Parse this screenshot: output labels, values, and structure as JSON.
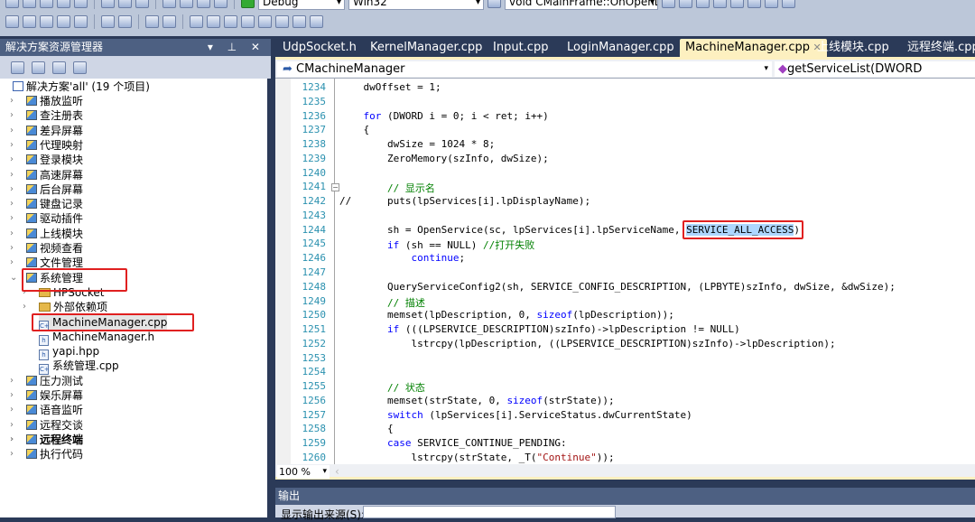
{
  "toolbar": {
    "config": "Debug",
    "platform": "Win32",
    "function_combo": "void CMainFrame::OnOpenDe"
  },
  "solution_explorer": {
    "title": "解决方案资源管理器",
    "buttons": "▾ ⊥ ✕",
    "root": "解决方案'all' (19 个项目)",
    "items": [
      {
        "label": "播放监听",
        "type": "project"
      },
      {
        "label": "查注册表",
        "type": "project"
      },
      {
        "label": "差异屏幕",
        "type": "project"
      },
      {
        "label": "代理映射",
        "type": "project"
      },
      {
        "label": "登录模块",
        "type": "project"
      },
      {
        "label": "高速屏幕",
        "type": "project"
      },
      {
        "label": "后台屏幕",
        "type": "project"
      },
      {
        "label": "键盘记录",
        "type": "project"
      },
      {
        "label": "驱动插件",
        "type": "project"
      },
      {
        "label": "上线模块",
        "type": "project"
      },
      {
        "label": "视频查看",
        "type": "project"
      },
      {
        "label": "文件管理",
        "type": "project"
      },
      {
        "label": "系统管理",
        "type": "project",
        "expanded": true,
        "highlighted": true
      },
      {
        "label": "HPSocket",
        "type": "folder",
        "child": true
      },
      {
        "label": "外部依赖项",
        "type": "folder",
        "child": true
      },
      {
        "label": "MachineManager.cpp",
        "type": "cpp",
        "child": true,
        "selected": true,
        "highlighted": true
      },
      {
        "label": "MachineManager.h",
        "type": "h",
        "child": true
      },
      {
        "label": "yapi.hpp",
        "type": "h",
        "child": true
      },
      {
        "label": "系统管理.cpp",
        "type": "cpp",
        "child": true
      },
      {
        "label": "压力测试",
        "type": "project"
      },
      {
        "label": "娱乐屏幕",
        "type": "project"
      },
      {
        "label": "语音监听",
        "type": "project"
      },
      {
        "label": "远程交谈",
        "type": "project"
      },
      {
        "label": "远程终端",
        "type": "project",
        "bold": true
      },
      {
        "label": "执行代码",
        "type": "project"
      }
    ]
  },
  "tabs": [
    {
      "label": "UdpSocket.h"
    },
    {
      "label": "KernelManager.cpp"
    },
    {
      "label": "Input.cpp"
    },
    {
      "label": "LoginManager.cpp"
    },
    {
      "label": "MachineManager.cpp",
      "active": true,
      "close": "✕"
    },
    {
      "label": "上线模块.cpp"
    },
    {
      "label": "远程终端.cpp"
    }
  ],
  "nav": {
    "class": "CMachineManager",
    "member": "getServiceList(DWORD dwScType)"
  },
  "code": {
    "lines": [
      {
        "n": "1234",
        "seg": [
          [
            "    dwOffset = 1;",
            ""
          ]
        ]
      },
      {
        "n": "1235",
        "seg": []
      },
      {
        "n": "1236",
        "seg": [
          [
            "    ",
            ""
          ],
          [
            "for",
            "k"
          ],
          [
            " (DWORD i = 0; i < ret; i++)",
            ""
          ]
        ]
      },
      {
        "n": "1237",
        "seg": [
          [
            "    {",
            ""
          ]
        ]
      },
      {
        "n": "1238",
        "seg": [
          [
            "        dwSize = 1024 * 8;",
            ""
          ]
        ]
      },
      {
        "n": "1239",
        "seg": [
          [
            "        ZeroMemory(szInfo, dwSize);",
            ""
          ]
        ]
      },
      {
        "n": "1240",
        "seg": []
      },
      {
        "n": "1241",
        "seg": [
          [
            "        ",
            ""
          ],
          [
            "// 显示名",
            "c"
          ]
        ]
      },
      {
        "n": "1242",
        "seg": [
          [
            "//      puts(lpServices[i].lpDisplayName);",
            ""
          ]
        ]
      },
      {
        "n": "1243",
        "seg": []
      },
      {
        "n": "1244",
        "seg": [
          [
            "        sh = OpenService(sc, lpServices[i].lpServiceName, ",
            ""
          ],
          [
            "SERVICE_ALL_ACCESS",
            "sel"
          ],
          [
            ");",
            ""
          ]
        ]
      },
      {
        "n": "1245",
        "seg": [
          [
            "        ",
            ""
          ],
          [
            "if",
            "k"
          ],
          [
            " (sh == NULL) ",
            ""
          ],
          [
            "//打开失败",
            "c"
          ]
        ]
      },
      {
        "n": "1246",
        "seg": [
          [
            "            ",
            ""
          ],
          [
            "continue",
            "k"
          ],
          [
            ";",
            ""
          ]
        ]
      },
      {
        "n": "1247",
        "seg": []
      },
      {
        "n": "1248",
        "seg": [
          [
            "        QueryServiceConfig2(sh, SERVICE_CONFIG_DESCRIPTION, (LPBYTE)szInfo, dwSize, &dwSize);",
            ""
          ]
        ]
      },
      {
        "n": "1249",
        "seg": [
          [
            "        ",
            ""
          ],
          [
            "// 描述",
            "c"
          ]
        ]
      },
      {
        "n": "1250",
        "seg": [
          [
            "        memset(lpDescription, 0, ",
            ""
          ],
          [
            "sizeof",
            "k"
          ],
          [
            "(lpDescription));",
            ""
          ]
        ]
      },
      {
        "n": "1251",
        "seg": [
          [
            "        ",
            ""
          ],
          [
            "if",
            "k"
          ],
          [
            " (((LPSERVICE_DESCRIPTION)szInfo)->lpDescription != NULL)",
            ""
          ]
        ]
      },
      {
        "n": "1252",
        "seg": [
          [
            "            lstrcpy(lpDescription, ((LPSERVICE_DESCRIPTION)szInfo)->lpDescription);",
            ""
          ]
        ]
      },
      {
        "n": "1253",
        "seg": []
      },
      {
        "n": "1254",
        "seg": []
      },
      {
        "n": "1255",
        "seg": [
          [
            "        ",
            ""
          ],
          [
            "// 状态",
            "c"
          ]
        ]
      },
      {
        "n": "1256",
        "seg": [
          [
            "        memset(strState, 0, ",
            ""
          ],
          [
            "sizeof",
            "k"
          ],
          [
            "(strState));",
            ""
          ]
        ]
      },
      {
        "n": "1257",
        "seg": [
          [
            "        ",
            ""
          ],
          [
            "switch",
            "k"
          ],
          [
            " (lpServices[i].ServiceStatus.dwCurrentState)",
            ""
          ]
        ]
      },
      {
        "n": "1258",
        "seg": [
          [
            "        {",
            ""
          ]
        ]
      },
      {
        "n": "1259",
        "seg": [
          [
            "        ",
            ""
          ],
          [
            "case",
            "k"
          ],
          [
            " SERVICE_CONTINUE_PENDING:",
            ""
          ]
        ]
      },
      {
        "n": "1260",
        "seg": [
          [
            "            lstrcpy(strState, _T(",
            ""
          ],
          [
            "\"Continue\"",
            "s"
          ],
          [
            "));",
            ""
          ]
        ]
      }
    ]
  },
  "zoom": "100 %",
  "output": {
    "title": "输出",
    "source_label": "显示输出来源(S):",
    "source_value": ""
  }
}
